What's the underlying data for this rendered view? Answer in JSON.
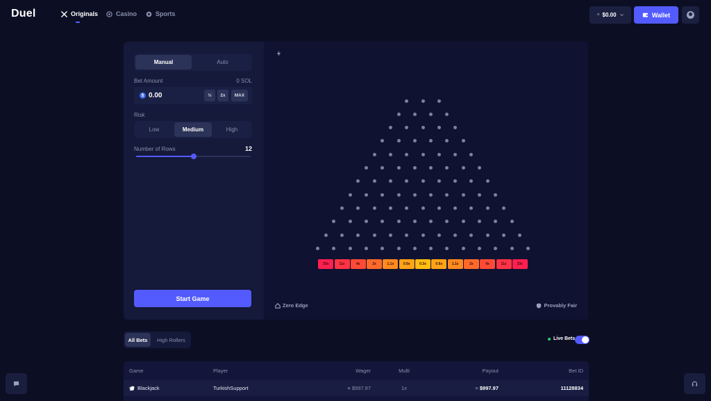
{
  "header": {
    "logo": "Duel",
    "nav": [
      {
        "label": "Originals",
        "icon": "crossed-swords-icon",
        "active": true
      },
      {
        "label": "Casino",
        "icon": "casino-chip-icon",
        "active": false
      },
      {
        "label": "Sports",
        "icon": "soccer-ball-icon",
        "active": false
      }
    ],
    "balance": "$0.00",
    "wallet_label": "Wallet"
  },
  "controls": {
    "modes": [
      "Manual",
      "Auto"
    ],
    "selected_mode": "Manual",
    "bet_amount_label": "Bet Amount",
    "bet_amount_sol": "0 SOL",
    "bet_value": "0.00",
    "half_label": "½",
    "double_label": "2x",
    "max_label": "MAX",
    "risk_label": "Risk",
    "risk_options": [
      "Low",
      "Medium",
      "High"
    ],
    "selected_risk": "Medium",
    "rows_label": "Number of Rows",
    "rows_value": "12",
    "rows_slider_fraction": 0.5,
    "start_label": "Start Game"
  },
  "board": {
    "rows": 12,
    "multipliers": [
      "33x",
      "11x",
      "4x",
      "2x",
      "1.1x",
      "0.6x",
      "0.3x",
      "0.6x",
      "1.1x",
      "2x",
      "4x",
      "11x",
      "33x"
    ],
    "bucket_colors": [
      "#ff1f4f",
      "#ff3344",
      "#ff4a35",
      "#ff6a2a",
      "#ff8a1f",
      "#ffa317",
      "#ffbd12",
      "#ffa317",
      "#ff8a1f",
      "#ff6a2a",
      "#ff4a35",
      "#ff3344",
      "#ff1f4f"
    ],
    "zero_edge_label": "Zero Edge",
    "provably_fair_label": "Provably Fair"
  },
  "bets": {
    "tabs": [
      "All Bets",
      "High Rollers"
    ],
    "selected_tab": "All Bets",
    "live_label": "Live Bets",
    "live_on": true,
    "columns": [
      "Game",
      "Player",
      "Wager",
      "Multi",
      "Payout",
      "Bet ID"
    ],
    "rows": [
      {
        "game": "Blackjack",
        "player": "TurkishSupport",
        "wager": "$997.97",
        "multi": "1x",
        "payout": "$997.97",
        "bet_id": "11128834"
      }
    ]
  },
  "colors": {
    "accent": "#535bff",
    "background": "#0c0f24"
  }
}
